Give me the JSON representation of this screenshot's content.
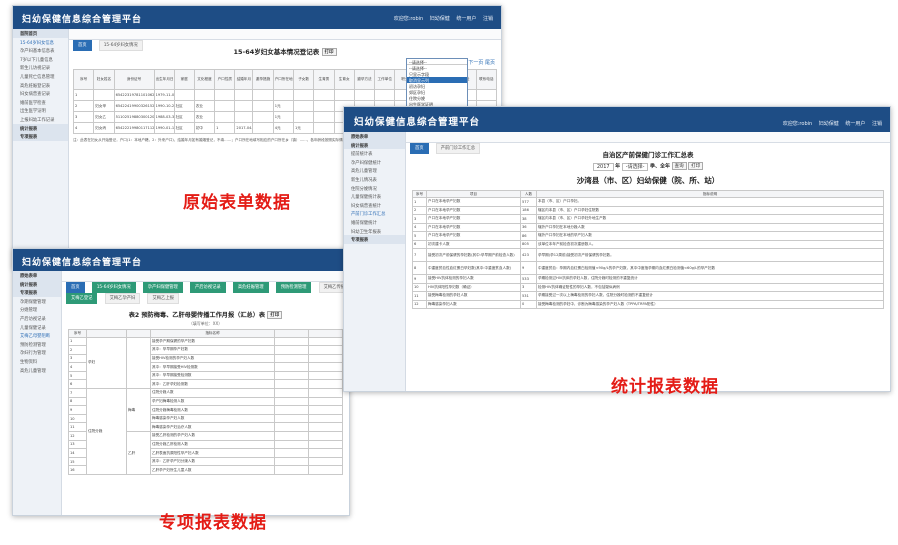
{
  "app_title": "妇幼保健信息综合管理平台",
  "w1": {
    "user": "欢迎您:robin",
    "hdr_links": [
      "妇幼保健",
      "统一用户",
      "注销"
    ],
    "side_items": [
      "首院首页",
      "15-64岁妇女信息",
      "孕产妇基本信息表",
      "7岁以下儿童信息",
      "新生儿访视记录",
      "儿童死亡信息管理",
      "高危妊娠登记表",
      "妇女病普查记录",
      "婚前医学检查",
      "出生医学证明",
      "上报妇幼工作记录",
      "统计报表",
      "专项报表"
    ],
    "tabs": [
      "首页",
      "15-64岁妇女情况"
    ],
    "title": "15-64岁妇女基本情况登记表",
    "print": "打印",
    "columns": [
      "序号",
      "妇女姓名",
      "身份证号",
      "出生年月日",
      "家庭",
      "文化程度",
      "户口性质",
      "结婚年月",
      "避孕措施",
      "户口所在地",
      "子女数",
      "生育男",
      "生育女",
      "避孕方法",
      "工作单位",
      "职业",
      "是否流动人口",
      "已婚育龄妇女",
      "住址",
      "联系电话"
    ],
    "rows": [
      [
        "1",
        "",
        "654223197811010624",
        "1979-11-01",
        "",
        "",
        "",
        "",
        "",
        "",
        "",
        "",
        "",
        "",
        "",
        "",
        "",
        "",
        "",
        ""
      ],
      [
        "2",
        "妇女甲",
        "654224199003261523",
        "1990-10-26",
        "社区",
        "农业",
        "",
        "",
        "",
        "1元",
        "",
        "",
        "",
        "",
        "",
        "",
        "",
        "",
        "",
        ""
      ],
      [
        "3",
        "妇女乙",
        "511025198803001202",
        "1988-03-30",
        "社区",
        "农业",
        "",
        "",
        "",
        "1元",
        "",
        "",
        "",
        "",
        "",
        "",
        "",
        "",
        "",
        ""
      ],
      [
        "4",
        "妇女丙",
        "654222199801171121",
        "1990-01-17",
        "社区",
        "初中",
        "1",
        "2017-04-01",
        "",
        "4元",
        "1元",
        "",
        "",
        "",
        "",
        "",
        "",
        "",
        "",
        ""
      ]
    ],
    "note": "注：此表在妇女从开始登记，户口(1：本地户籍，2：外来户口)，结婚年月如有婚姻登记，不填……；户口所在地填写相应的户口所在乡（镇）……，各年龄段按照实际情况……",
    "dropdown": [
      "--请选择--",
      "--请选择--",
      "只显示字段",
      "取消显示列",
      "初访孕妇",
      "郊区孕妇",
      "住院分娩",
      "出生医学证明",
      "未生育",
      "设置排序",
      "导出"
    ],
    "paging": "1/1 下一页 尾页"
  },
  "w2": {
    "user": "欢迎您:robin",
    "hdr_links": [
      "妇幼保健",
      "统一用户",
      "注销"
    ],
    "side_items": [
      "原始表单",
      "统计报表",
      "提前统计表",
      "孕产妇保健统计",
      "高危儿童管理",
      "新生儿情况表",
      "住院分娩情况",
      "儿童保健统计表",
      "妇女病普查统计",
      "产前门诊工作汇总",
      "婚前保健统计",
      "妇幼卫生年报表",
      "专项报表"
    ],
    "tabs": [
      "首页",
      "产前门诊工作汇总"
    ],
    "title": "自治区产前保健门诊工作汇总表",
    "year": "2017",
    "year_suffix": "年",
    "select": "-请选择-",
    "period": "季、全年",
    "btn_query": "查询",
    "btn_print": "打印",
    "subtitle": "沙湾县（市、区）妇幼保健（院、所、站）",
    "columns": [
      "序号",
      "项目",
      "人数",
      "指标说明"
    ],
    "rows": [
      [
        "1",
        "户口在本地孕产妇数",
        "577",
        "本县（市、区）户口孕妇。"
      ],
      [
        "2",
        "户口在本地孕产妇数",
        "186",
        "辖区内本县（市、区）户口孕妇住院数"
      ],
      [
        "3",
        "户口在本地孕产妇数",
        "38",
        "辖区内本县（市、区）户口孕妇外地生产数"
      ],
      [
        "4",
        "户口在本地孕产妇数",
        "36",
        "辖外户口孕妇在本地分娩人数"
      ],
      [
        "5",
        "户口在本地孕产妇数",
        "86",
        "辖外户口孕妇在本地的孕产妇人数"
      ],
      [
        "6",
        "初次建卡人数",
        "805",
        "该单位本年产前检查初次建册数人。"
      ],
      [
        "7",
        "接受初次产前保健的孕妇数(其中:孕早期产前检查人数)",
        "423",
        "孕早期(孕12周前)接受初次产前保健的孕妇数。"
      ],
      [
        "8",
        "中重度贫血性血红蛋白孕妇数(其中:中重度贫血人数)",
        "9",
        "中重度贫血：孕期内血红蛋白检测值<90g/L的孕产妇数，其中中度指孕期内血红蛋白检测值<60g/L的孕产妇数"
      ],
      [
        "9",
        "接受HIV抗体检测的孕妇人数",
        "533",
        "孕期检测过HIV抗体的孕妇人数，住院分娩时检测的不重复统计"
      ],
      [
        "10",
        "HIV抗体阳性孕妇数（确证）",
        "3",
        "检测HIV抗体确证阳性的孕妇人数，不包括疑似病例"
      ],
      [
        "11",
        "接受梅毒检测的孕妇人数",
        "531",
        "孕期接受过一次以上梅毒检测的孕妇人数，住院分娩时检测的不重复统计"
      ],
      [
        "12",
        "梅毒感染孕妇人数",
        "0",
        "接受梅毒检测的孕妇中，诊断为梅毒感染的孕产妇人数（TPPA/TRPA阳性）"
      ]
    ]
  },
  "w3": {
    "side_items": [
      "原始表单",
      "统计报表",
      "专项报表",
      "孕期保健管理",
      "分娩管理",
      "产后访视记录",
      "儿童保健记录",
      "艾梅乙母婴阻断",
      "预防检测管理",
      "孕妇行为管理",
      "生物资料",
      "高危儿童管理"
    ],
    "tabs": [
      "首页",
      "15-64岁妇女情况",
      "孕产妇保健管理",
      "产后访视记录",
      "高危妊娠管理",
      "预防检测管理",
      "艾梅乙母婴阻断"
    ],
    "tab_extra": "艾梅乙传播阻断",
    "subtabs": [
      "艾梅乙登记",
      "艾梅乙孕产妇",
      "艾梅乙上报"
    ],
    "title": "表2 预防梅毒、乙肝母婴传播工作月报（汇总）表",
    "subnote": "（填写单位：XX）",
    "btn_print": "打印",
    "col_head": [
      "序号",
      "",
      "指标名称",
      ""
    ],
    "group_a": "孕妇",
    "group_b": "住院分娩",
    "group_c": "梅毒",
    "group_d": "乙肝",
    "items": [
      "接受孕产期保健的孕产妇数",
      "其中：孕早期孕产妇数",
      "接受HIV检测的孕产妇人数",
      "其中：孕早期接受HIV检测数",
      "其中：孕早期接受检测数",
      "其中：乙肝孕妇检测数",
      "住院分娩人数",
      "孕产妇梅毒检测人数",
      "住院分娩梅毒检测人数",
      "梅毒感染孕产妇人数",
      "梅毒感染孕产妇治疗人数",
      "接受乙肝检测的孕产妇人数",
      "住院分娩乙肝检测人数",
      "乙肝表面抗原阳性孕产妇人数",
      "其中：乙肝孕产妇分娩人数",
      "乙肝孕产妇所生儿童人数"
    ]
  },
  "labels": {
    "raw": "原始表单数据",
    "stat": "统计报表数据",
    "special": "专项报表数据"
  }
}
